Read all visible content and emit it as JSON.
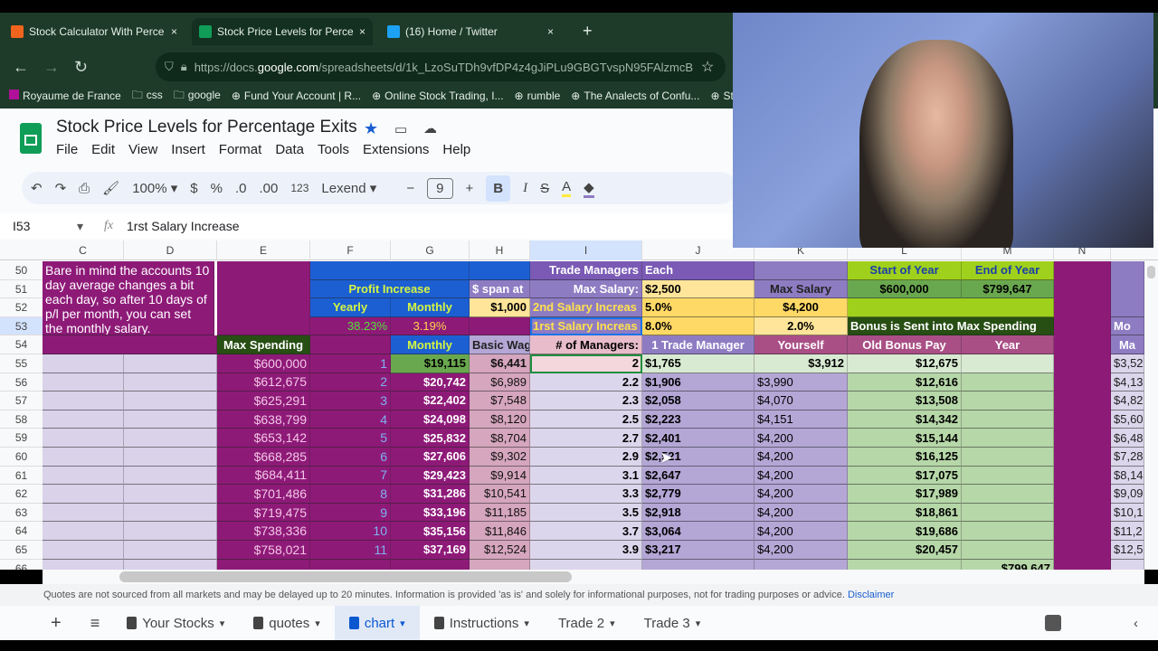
{
  "browser": {
    "tabs": [
      {
        "label": "Stock Calculator With Percentag",
        "icon": "etsy-icon",
        "color": "#f1641e"
      },
      {
        "label": "Stock Price Levels for Percentag",
        "icon": "sheets-icon",
        "color": "#0f9d58",
        "active": true
      },
      {
        "label": "(16) Home / Twitter",
        "icon": "twitter-icon",
        "color": "#1da1f2"
      }
    ],
    "url_prefix": "https://docs.",
    "url_domain": "google.com",
    "url_path": "/spreadsheets/d/1k_LzoSuTDh9vfDP4z4gJiPLu9GBGTvspN95FAlzmcB",
    "bookmarks": [
      "Royaume de France",
      "css",
      "google",
      "Fund Your Account | R...",
      "Online Stock Trading, I...",
      "rumble",
      "The Analects of Confu...",
      "Stock"
    ]
  },
  "doc": {
    "title": "Stock Price Levels for Percentage Exits",
    "menus": [
      "File",
      "Edit",
      "View",
      "Insert",
      "Format",
      "Data",
      "Tools",
      "Extensions",
      "Help"
    ]
  },
  "toolbar": {
    "zoom": "100%",
    "currency": "$",
    "percent": "%",
    "dec_dec": ".0",
    "inc_dec": ".00",
    "format": "123",
    "font": "Lexend",
    "font_size": "9",
    "bold": "B",
    "italic": "I",
    "strike": "S",
    "text_color": "A"
  },
  "formula": {
    "cell_ref": "I53",
    "fx": "fx",
    "value": "1rst Salary Increase"
  },
  "columns": [
    "C",
    "D",
    "E",
    "F",
    "G",
    "H",
    "I",
    "J",
    "K",
    "L",
    "M",
    "N"
  ],
  "header_cells": {
    "note": "Bare in mind the accounts 10 day average changes a bit each day, so after 10 days of p/l per month, you can set the monthly salary.",
    "max_spending": "Max Spending",
    "profit_increase": "Profit Increase",
    "span_at": "$ span at",
    "yearly": "Yearly",
    "monthly": "Monthly",
    "span_value": "$1,000",
    "yearly_pct": "38.23%",
    "monthly_pct": "3.19%",
    "monthly2": "Monthly",
    "basic_wage": "Basic Wag",
    "trade_managers": "Trade Managers",
    "each": "Each",
    "max_salary_label": "Max Salary:",
    "max_salary_value": "$2,500",
    "second_increase_label": "2nd Salary Increas",
    "second_increase_value": "5.0%",
    "first_increase_label": "1rst Salary Increas",
    "first_increase_value": "8.0%",
    "num_managers": "# of Managers:",
    "one_trade_manager": "1 Trade Manager",
    "max_salary_k": "Max Salary",
    "max_salary_k_value": "$4,200",
    "k_pct": "2.0%",
    "yourself": "Yourself",
    "start_of_year": "Start of Year",
    "end_of_year": "End of Year",
    "start_value": "$600,000",
    "end_value": "$799,647",
    "bonus_note": "Bonus is Sent into Max Spending",
    "old_bonus_pay": "Old Bonus Pay",
    "year": "Year",
    "o53": "Mo",
    "o54": "Ma"
  },
  "rows": [
    {
      "n": 55,
      "E": "$600,000",
      "F": "1",
      "G": "$19,115",
      "H": "$6,441",
      "I": "2",
      "J": "$1,765",
      "K": "$3,912",
      "L": "$12,675",
      "M": "",
      "O": "$3,52"
    },
    {
      "n": 56,
      "E": "$612,675",
      "F": "2",
      "G": "$20,742",
      "H": "$6,989",
      "I": "2.2",
      "J": "$1,906",
      "K": "$3,990",
      "L": "$12,616",
      "M": "",
      "O": "$4,13"
    },
    {
      "n": 57,
      "E": "$625,291",
      "F": "3",
      "G": "$22,402",
      "H": "$7,548",
      "I": "2.3",
      "J": "$2,058",
      "K": "$4,070",
      "L": "$13,508",
      "M": "",
      "O": "$4,82"
    },
    {
      "n": 58,
      "E": "$638,799",
      "F": "4",
      "G": "$24,098",
      "H": "$8,120",
      "I": "2.5",
      "J": "$2,223",
      "K": "$4,151",
      "L": "$14,342",
      "M": "",
      "O": "$5,60"
    },
    {
      "n": 59,
      "E": "$653,142",
      "F": "5",
      "G": "$25,832",
      "H": "$8,704",
      "I": "2.7",
      "J": "$2,401",
      "K": "$4,200",
      "L": "$15,144",
      "M": "",
      "O": "$6,48"
    },
    {
      "n": 60,
      "E": "$668,285",
      "F": "6",
      "G": "$27,606",
      "H": "$9,302",
      "I": "2.9",
      "J": "$2,521",
      "K": "$4,200",
      "L": "$16,125",
      "M": "",
      "O": "$7,28"
    },
    {
      "n": 61,
      "E": "$684,411",
      "F": "7",
      "G": "$29,423",
      "H": "$9,914",
      "I": "3.1",
      "J": "$2,647",
      "K": "$4,200",
      "L": "$17,075",
      "M": "",
      "O": "$8,14"
    },
    {
      "n": 62,
      "E": "$701,486",
      "F": "8",
      "G": "$31,286",
      "H": "$10,541",
      "I": "3.3",
      "J": "$2,779",
      "K": "$4,200",
      "L": "$17,989",
      "M": "",
      "O": "$9,09"
    },
    {
      "n": 63,
      "E": "$719,475",
      "F": "9",
      "G": "$33,196",
      "H": "$11,185",
      "I": "3.5",
      "J": "$2,918",
      "K": "$4,200",
      "L": "$18,861",
      "M": "",
      "O": "$10,1"
    },
    {
      "n": 64,
      "E": "$738,336",
      "F": "10",
      "G": "$35,156",
      "H": "$11,846",
      "I": "3.7",
      "J": "$3,064",
      "K": "$4,200",
      "L": "$19,686",
      "M": "",
      "O": "$11,2"
    },
    {
      "n": 65,
      "E": "$758,021",
      "F": "11",
      "G": "$37,169",
      "H": "$12,524",
      "I": "3.9",
      "J": "$3,217",
      "K": "$4,200",
      "L": "$20,457",
      "M": "",
      "O": "$12,5"
    },
    {
      "n": 66,
      "E": "",
      "F": "",
      "G": "",
      "H": "",
      "I": "",
      "J": "",
      "K": "",
      "L": "",
      "M": "$799,647",
      "O": ""
    }
  ],
  "header_row_numbers": [
    50,
    51,
    52,
    53,
    54
  ],
  "disclaimer": {
    "text": "Quotes are not sourced from all markets and may be delayed up to 20 minutes. Information is provided 'as is' and solely for informational purposes, not for trading purposes or advice.",
    "link": "Disclaimer"
  },
  "sheet_tabs": [
    {
      "label": "Your Stocks",
      "locked": true
    },
    {
      "label": "quotes",
      "locked": true
    },
    {
      "label": "chart",
      "locked": true,
      "active": true
    },
    {
      "label": "Instructions",
      "locked": true
    },
    {
      "label": "Trade 2"
    },
    {
      "label": "Trade 3"
    }
  ],
  "colors": {
    "magenta": "#8e1a78",
    "blue": "#1c5fd3",
    "purple": "#8e7cc3",
    "lavender": "#b4a7d6",
    "green": "#6aa84f",
    "light_green": "#b6d7a8",
    "lime": "#9fd11c",
    "dark_green": "#274e13",
    "yellow": "#ffd966",
    "pale_yellow": "#ffe599",
    "pink": "#d5a6bd",
    "rose": "#a94f86"
  }
}
